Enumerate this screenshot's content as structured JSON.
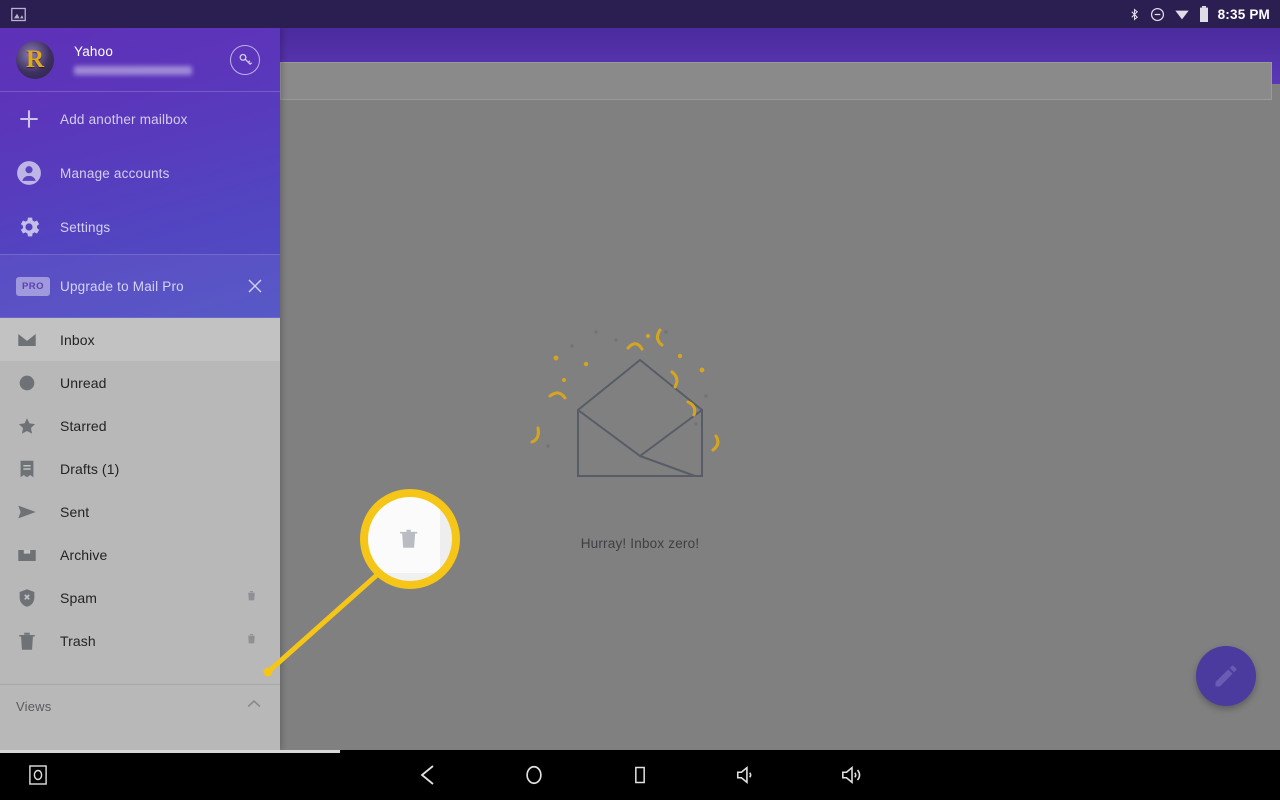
{
  "status_bar": {
    "notification_icon": "image-notification-icon",
    "icons": [
      "bluetooth-icon",
      "do-not-disturb-icon",
      "wifi-icon",
      "battery-icon"
    ],
    "time": "8:35 PM"
  },
  "drawer": {
    "account": {
      "avatar_letter": "R",
      "name": "Yahoo",
      "email_hidden": true,
      "key_icon": "account-key-icon"
    },
    "top_items": [
      {
        "label": "Add another mailbox",
        "icon": "plus-icon"
      },
      {
        "label": "Manage accounts",
        "icon": "person-icon"
      },
      {
        "label": "Settings",
        "icon": "gear-icon"
      }
    ],
    "promo": {
      "badge": "PRO",
      "label": "Upgrade to Mail Pro",
      "close_icon": "close-icon"
    },
    "folders": [
      {
        "label": "Inbox",
        "icon": "envelope-icon",
        "selected": true,
        "trailing": null
      },
      {
        "label": "Unread",
        "icon": "circle-icon",
        "selected": false,
        "trailing": null
      },
      {
        "label": "Starred",
        "icon": "star-icon",
        "selected": false,
        "trailing": null
      },
      {
        "label": "Drafts (1)",
        "icon": "draft-icon",
        "selected": false,
        "trailing": null
      },
      {
        "label": "Sent",
        "icon": "send-icon",
        "selected": false,
        "trailing": null
      },
      {
        "label": "Archive",
        "icon": "archive-icon",
        "selected": false,
        "trailing": null
      },
      {
        "label": "Spam",
        "icon": "shield-x-icon",
        "selected": false,
        "trailing": "trash-icon"
      },
      {
        "label": "Trash",
        "icon": "trash-icon",
        "selected": false,
        "trailing": "trash-icon"
      }
    ],
    "views": {
      "label": "Views",
      "chevron": "chevron-up-icon"
    }
  },
  "main": {
    "search_placeholder": "",
    "empty_state": {
      "illustration": "open-envelope-confetti-illustration",
      "text": "Hurray! Inbox zero!"
    },
    "compose_button": "compose-pencil-icon"
  },
  "callout": {
    "type": "magnifier",
    "zoomed_icon": "trash-icon",
    "target": "trash-row-delete-icon",
    "accent_color": "#f5c518"
  },
  "nav_bar": {
    "screenshot_icon": "screenshot-icon",
    "buttons": [
      "back-icon",
      "home-icon",
      "recents-icon",
      "volume-down-icon",
      "volume-up-icon"
    ]
  },
  "colors": {
    "drawer_purple_top": "#5e31b8",
    "drawer_purple_bottom": "#5050c4",
    "drawer_gray": "#b8b8b8",
    "scrim_gray": "#808080",
    "accent_yellow": "#f5c518",
    "fab_purple": "#4b3b9e"
  }
}
